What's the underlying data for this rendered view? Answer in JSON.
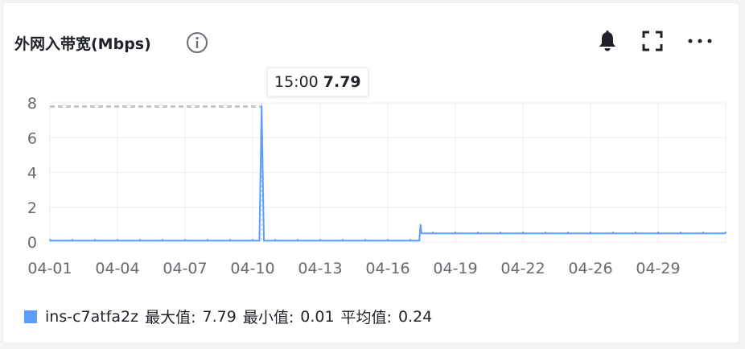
{
  "title": "外网入带宽(Mbps)",
  "icons": {
    "info": "info-icon",
    "bell": "bell-icon",
    "fullscreen": "fullscreen-icon",
    "more": "more-icon"
  },
  "tooltip": {
    "time": "15:00",
    "value": "7.79"
  },
  "legend": {
    "series_name": "ins-c7atfa2z",
    "max_label": "最大值:",
    "max_value": "7.79",
    "min_label": "最小值:",
    "min_value": "0.01",
    "avg_label": "平均值:",
    "avg_value": "0.24"
  },
  "colors": {
    "series": "#5c9eff",
    "grid": "#ebedf0",
    "text": "#1f2329",
    "axis_text": "#666a70"
  },
  "chart_data": {
    "type": "line",
    "xlabel": "",
    "ylabel": "",
    "ylim": [
      0,
      8
    ],
    "yticks": [
      0,
      2,
      4,
      6,
      8
    ],
    "grid": true,
    "xlim": [
      0,
      30
    ],
    "x_tick_labels": [
      "04-01",
      "04-04",
      "04-07",
      "04-10",
      "04-13",
      "04-16",
      "04-19",
      "04-22",
      "04-26",
      "04-29"
    ],
    "x_tick_positions": [
      0,
      3,
      6,
      9,
      12,
      15,
      18,
      21,
      24,
      27
    ],
    "reference_line": {
      "value": 7.79,
      "style": "dashed",
      "from_x": 0,
      "to_x": 9.4
    },
    "series": [
      {
        "name": "ins-c7atfa2z",
        "x": [
          0,
          1,
          2,
          3,
          4,
          5,
          6,
          7,
          8,
          9,
          9.3,
          9.4,
          9.5,
          9.7,
          10,
          11,
          12,
          13,
          14,
          15,
          16,
          16.4,
          16.45,
          16.5,
          17,
          18,
          19,
          20,
          21,
          22,
          23,
          24,
          25,
          26,
          27,
          28,
          29,
          30
        ],
        "y": [
          0.08,
          0.08,
          0.08,
          0.08,
          0.08,
          0.08,
          0.08,
          0.08,
          0.08,
          0.08,
          0.08,
          7.79,
          0.08,
          0.08,
          0.08,
          0.08,
          0.08,
          0.08,
          0.08,
          0.08,
          0.08,
          0.08,
          1.0,
          0.5,
          0.5,
          0.5,
          0.5,
          0.5,
          0.5,
          0.5,
          0.5,
          0.5,
          0.5,
          0.5,
          0.5,
          0.5,
          0.5,
          0.5
        ]
      }
    ]
  }
}
